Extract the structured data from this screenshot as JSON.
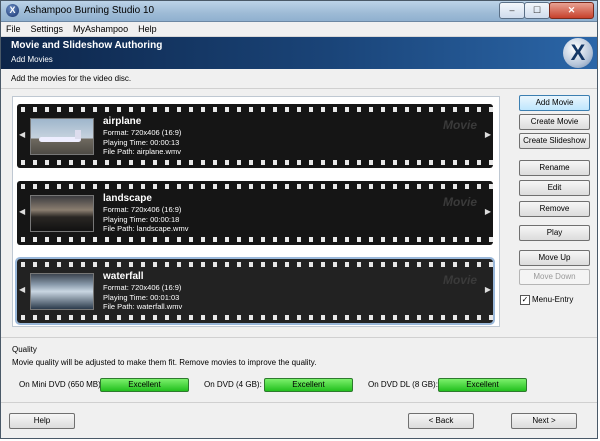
{
  "window": {
    "title": "Ashampoo Burning Studio 10",
    "controls": {
      "minimize": "–",
      "maximize": "☐",
      "close": "✕"
    }
  },
  "menu": [
    "File",
    "Settings",
    "MyAshampoo",
    "Help"
  ],
  "header": {
    "title": "Movie and Slideshow Authoring",
    "subtitle": "Add Movies",
    "logo": "X"
  },
  "instruction": "Add the movies for the video disc.",
  "movies": [
    {
      "name": "airplane",
      "format": "Format: 720x406 (16:9)",
      "time": "Playing Time: 00:00:13",
      "path": "File Path: airplane.wmv",
      "tag": "Movie",
      "selected": false
    },
    {
      "name": "landscape",
      "format": "Format: 720x406 (16:9)",
      "time": "Playing Time: 00:00:18",
      "path": "File Path: landscape.wmv",
      "tag": "Movie",
      "selected": false
    },
    {
      "name": "waterfall",
      "format": "Format: 720x406 (16:9)",
      "time": "Playing Time: 00:01:03",
      "path": "File Path: waterfall.wmv",
      "tag": "Movie",
      "selected": true
    }
  ],
  "side_buttons": {
    "add_movie": "Add Movie",
    "create_movie": "Create Movie",
    "create_slideshow": "Create Slideshow",
    "rename": "Rename",
    "edit": "Edit",
    "remove": "Remove",
    "play": "Play",
    "move_up": "Move Up",
    "move_down": "Move Down"
  },
  "menu_entry": {
    "label": "Menu-Entry",
    "checked": true,
    "mark": "✓"
  },
  "quality": {
    "title": "Quality",
    "note": "Movie quality will be adjusted to make them fit. Remove movies to improve the quality.",
    "items": [
      {
        "label": "On Mini DVD (650 MB):",
        "value": "Excellent"
      },
      {
        "label": "On DVD (4 GB):",
        "value": "Excellent"
      },
      {
        "label": "On DVD DL (8 GB):",
        "value": "Excellent"
      }
    ]
  },
  "footer": {
    "help": "Help",
    "back": "< Back",
    "next": "Next >"
  },
  "colors": {
    "header_dark": "#0d2549",
    "header_light": "#2b66a8",
    "quality_green": "#22c01e"
  }
}
